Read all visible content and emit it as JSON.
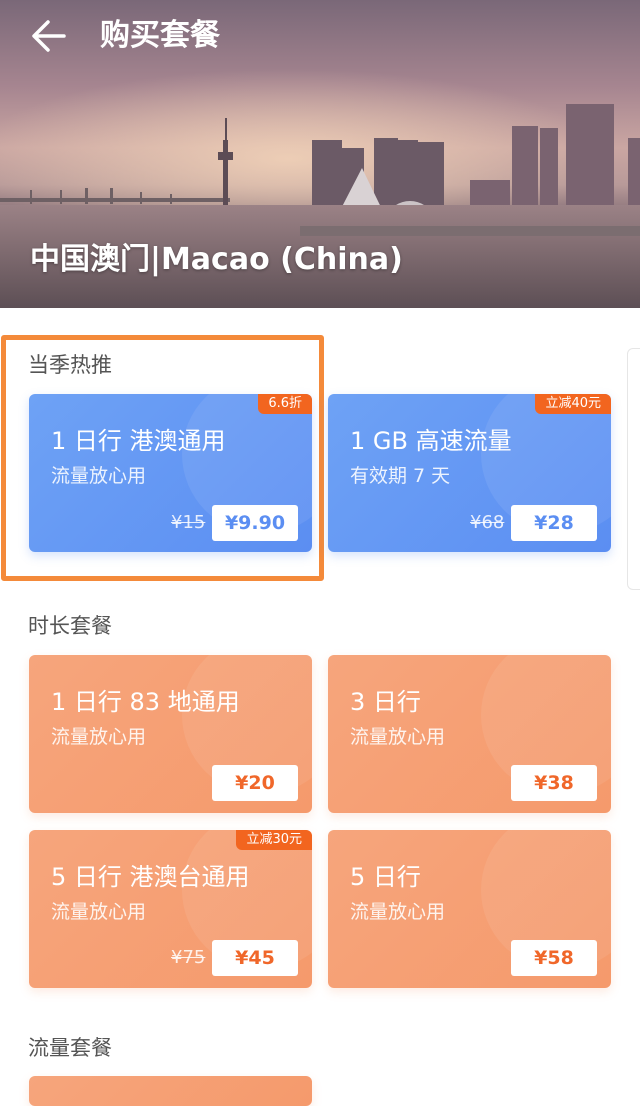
{
  "header": {
    "title": "购买套餐",
    "destination": "中国澳门|Macao (China)"
  },
  "sections": {
    "hot": "当季热推",
    "duration": "时长套餐",
    "data": "流量套餐"
  },
  "hot_cards": [
    {
      "name": "1 日行  港澳通用",
      "sub": "流量放心用",
      "badge": "6.6折",
      "old_price": "¥15",
      "price": "¥9.90"
    },
    {
      "name": "1 GB 高速流量",
      "sub": "有效期 7 天",
      "badge": "立减40元",
      "old_price": "¥68",
      "price": "¥28"
    }
  ],
  "duration_cards": [
    {
      "name": "1 日行  83 地通用",
      "sub": "流量放心用",
      "price": "¥20"
    },
    {
      "name": "3 日行",
      "sub": "流量放心用",
      "price": "¥38"
    },
    {
      "name": "5 日行  港澳台通用",
      "sub": "流量放心用",
      "badge": "立减30元",
      "old_price": "¥75",
      "price": "¥45"
    },
    {
      "name": "5 日行",
      "sub": "流量放心用",
      "price": "¥58"
    }
  ],
  "colors": {
    "accent_blue": "#5b8ef2",
    "accent_orange": "#f59a6c",
    "badge": "#f2651f",
    "highlight": "#f48a3a"
  },
  "icons": {
    "back": "arrow-left-icon"
  }
}
